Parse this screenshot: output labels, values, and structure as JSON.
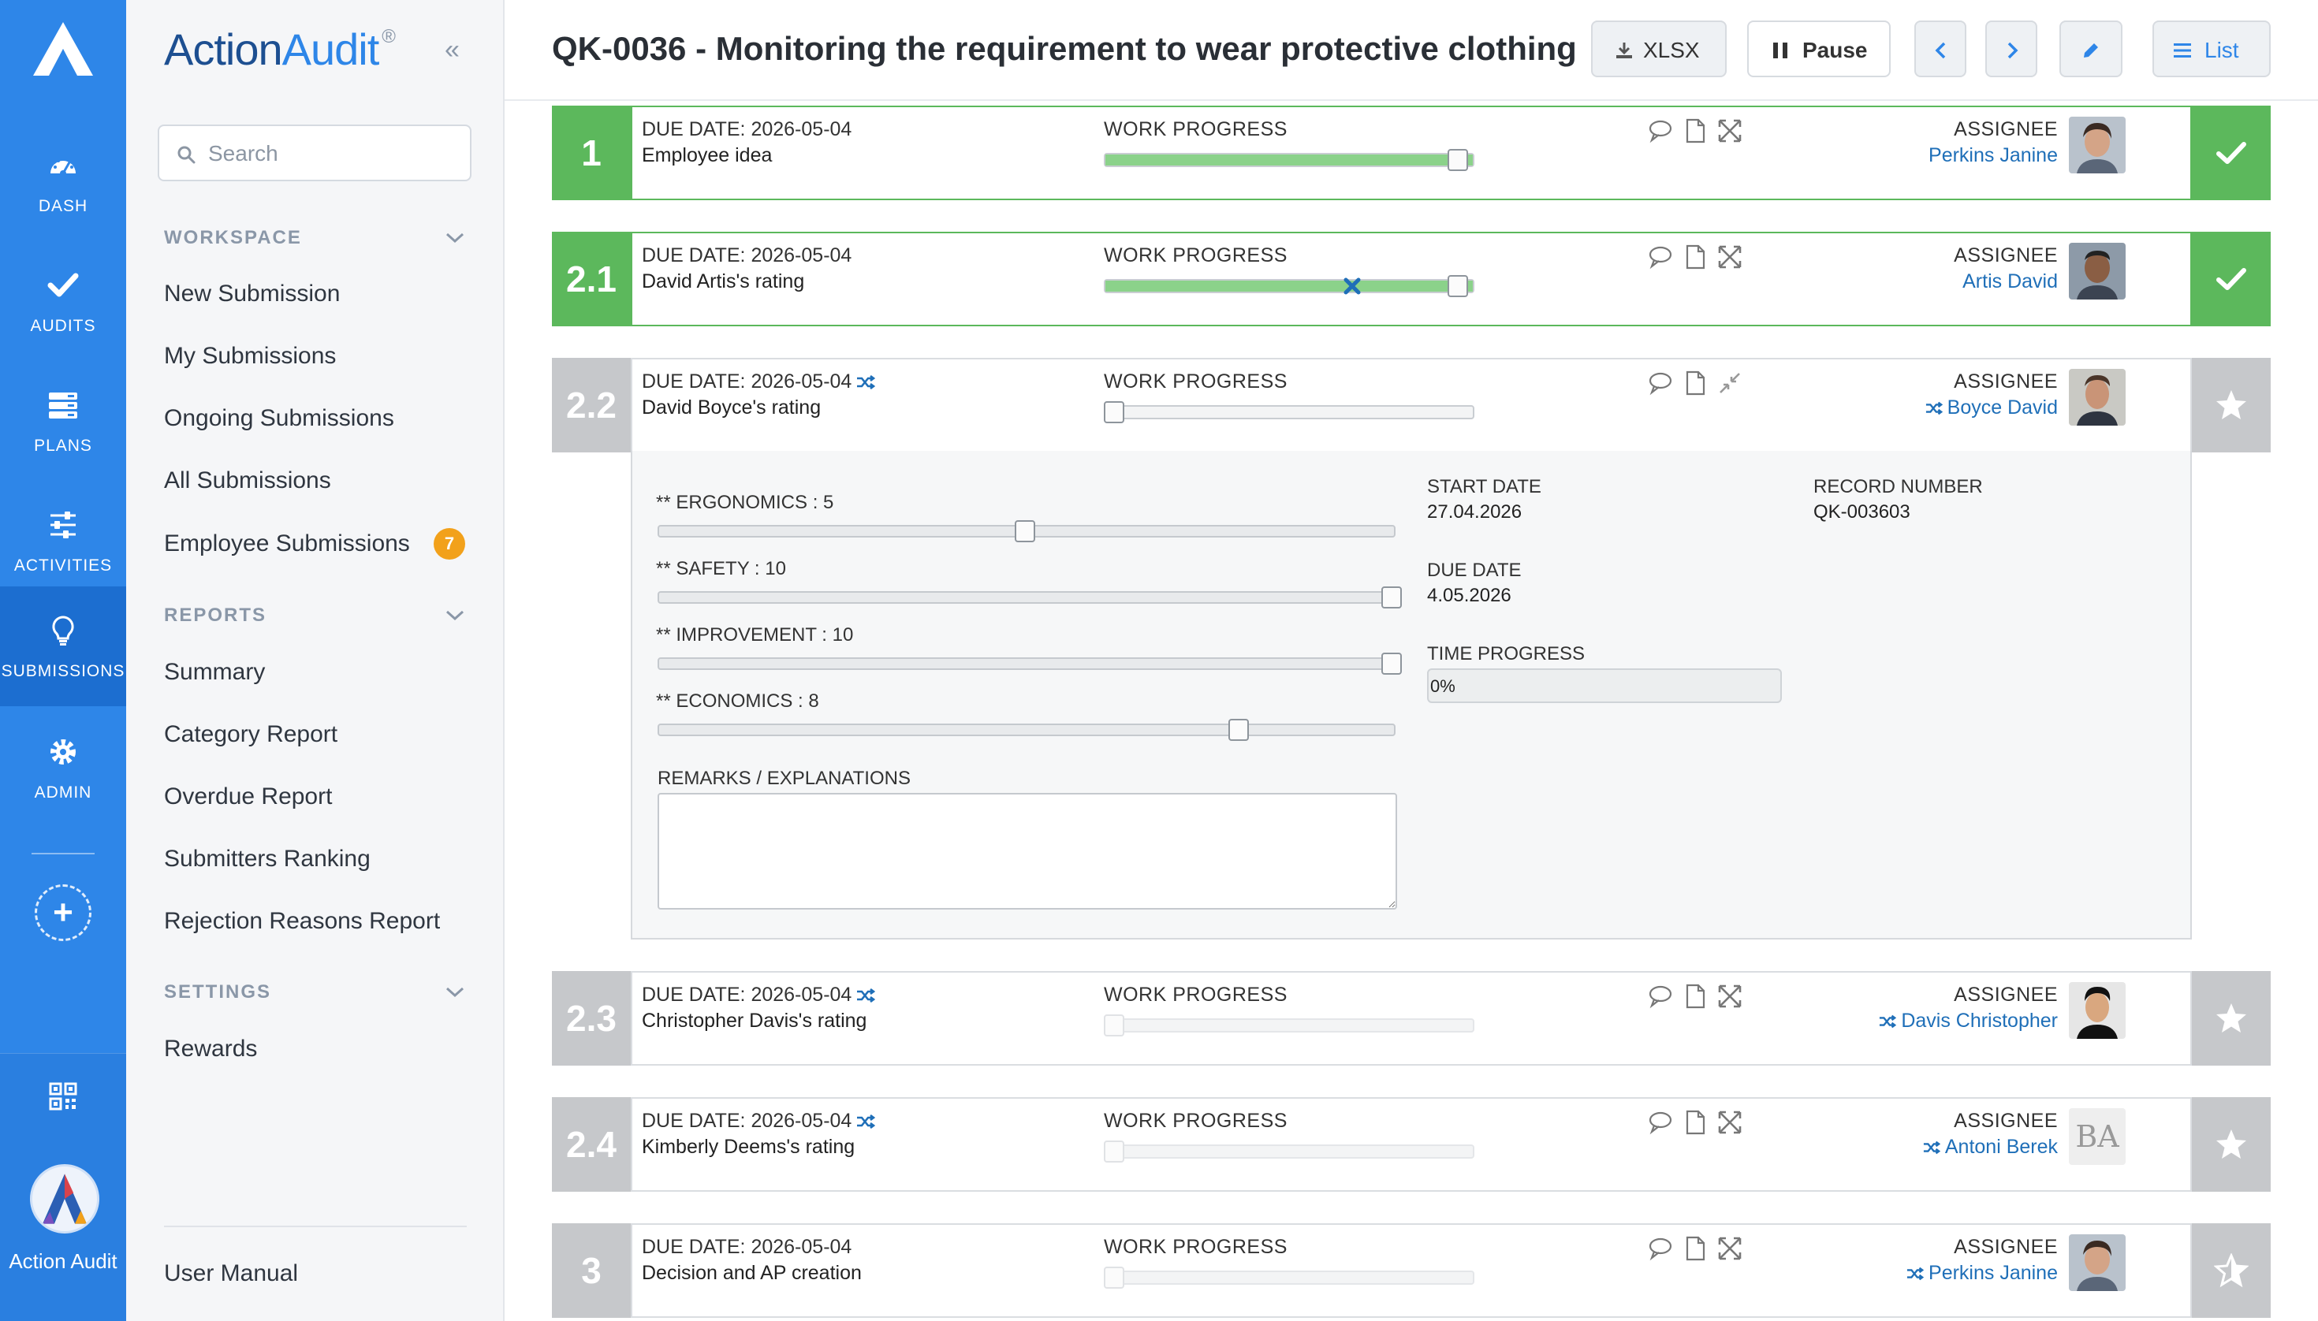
{
  "rail": {
    "items": [
      {
        "label": "DASH",
        "icon": "dashboard-icon"
      },
      {
        "label": "AUDITS",
        "icon": "check-icon"
      },
      {
        "label": "PLANS",
        "icon": "plans-icon"
      },
      {
        "label": "ACTIVITIES",
        "icon": "sliders-icon"
      },
      {
        "label": "SUBMISSIONS",
        "icon": "lightbulb-icon"
      },
      {
        "label": "ADMIN",
        "icon": "gear-icon"
      }
    ],
    "active": "SUBMISSIONS",
    "brand_label": "Action Audit"
  },
  "side": {
    "brand_part1": "Action",
    "brand_part2": "Audit",
    "brand_mark": "®",
    "collapse_glyph": "«",
    "search_placeholder": "Search",
    "sections": {
      "workspace": "WORKSPACE",
      "reports": "REPORTS",
      "settings": "SETTINGS"
    },
    "workspace_items": [
      "New Submission",
      "My Submissions",
      "Ongoing Submissions",
      "All Submissions",
      "Employee Submissions"
    ],
    "employee_badge": "7",
    "report_items": [
      "Summary",
      "Category Report",
      "Overdue Report",
      "Submitters Ranking",
      "Rejection Reasons Report"
    ],
    "settings_items": [
      "Rewards"
    ],
    "footer_item": "User Manual"
  },
  "header": {
    "title": "QK-0036 - Monitoring the requirement to wear protective clothing",
    "xlsx": "XLSX",
    "pause": "Pause",
    "list": "List"
  },
  "common": {
    "work_progress": "WORK PROGRESS",
    "assignee": "ASSIGNEE"
  },
  "cards": [
    {
      "num": "1",
      "due": "DUE DATE: 2026-05-04",
      "subject": "Employee idea",
      "assignee": "Perkins Janine",
      "progress": 1.0,
      "status": "done"
    },
    {
      "num": "2.1",
      "due": "DUE DATE: 2026-05-04",
      "subject": "David Artis's rating",
      "assignee": "Artis David",
      "progress": 1.0,
      "status": "done"
    },
    {
      "num": "2.2",
      "due": "DUE DATE: 2026-05-04",
      "subject": "David Boyce's rating",
      "assignee": "Boyce David",
      "progress": 0.0,
      "status": "open"
    },
    {
      "num": "2.3",
      "due": "DUE DATE: 2026-05-04",
      "subject": "Christopher Davis's rating",
      "assignee": "Davis Christopher",
      "progress": 0.0,
      "status": "open"
    },
    {
      "num": "2.4",
      "due": "DUE DATE: 2026-05-04",
      "subject": "Kimberly Deems's rating",
      "assignee": "Antoni Berek",
      "initials": "BA",
      "progress": 0.0,
      "status": "open"
    },
    {
      "num": "3",
      "due": "DUE DATE: 2026-05-04",
      "subject": "Decision and AP creation",
      "assignee": "Perkins Janine",
      "progress": 0.0,
      "status": "open"
    }
  ],
  "detail": {
    "criteria": [
      {
        "label": "**  ERGONOMICS : 5",
        "value": 5,
        "max": 10
      },
      {
        "label": "**  SAFETY : 10",
        "value": 10,
        "max": 10
      },
      {
        "label": "**  IMPROVEMENT : 10",
        "value": 10,
        "max": 10
      },
      {
        "label": "**  ECONOMICS : 8",
        "value": 8,
        "max": 10
      }
    ],
    "remarks_label": "REMARKS / EXPLANATIONS",
    "remarks_value": "",
    "start_date_label": "START DATE",
    "start_date": "27.04.2026",
    "due_date_label": "DUE DATE",
    "due_date": "4.05.2026",
    "time_progress_label": "TIME PROGRESS",
    "time_progress": "0%",
    "record_number_label": "RECORD NUMBER",
    "record_number": "QK-003603"
  },
  "colors": {
    "rail": "#2e86e8",
    "done": "#5cb85c",
    "pending": "#c6c8cb",
    "link": "#1f6fb8",
    "badge": "#f2a11b"
  }
}
